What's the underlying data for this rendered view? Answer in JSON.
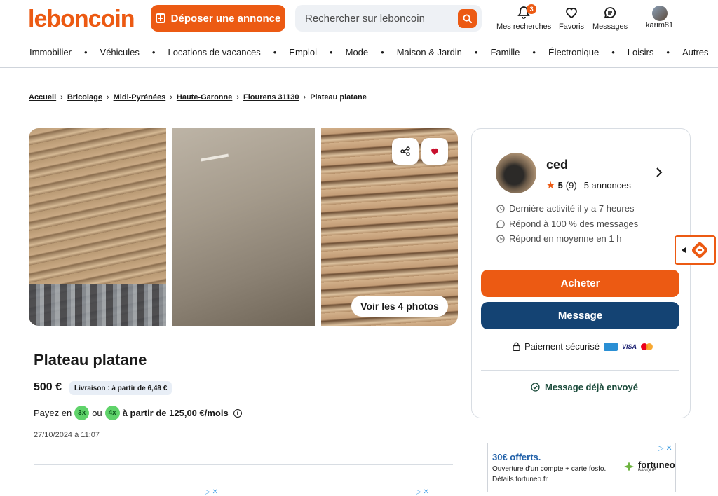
{
  "header": {
    "logo": "leboncoin",
    "deposer_label": "Déposer une annonce",
    "search_placeholder": "Rechercher sur leboncoin",
    "notif_count": "3",
    "items": {
      "recherches": "Mes recherches",
      "favoris": "Favoris",
      "messages": "Messages",
      "user": "karim81"
    }
  },
  "nav": [
    "Immobilier",
    "Véhicules",
    "Locations de vacances",
    "Emploi",
    "Mode",
    "Maison & Jardin",
    "Famille",
    "Électronique",
    "Loisirs",
    "Autres"
  ],
  "breadcrumb": {
    "items": [
      "Accueil",
      "Bricolage",
      "Midi-Pyrénées",
      "Haute-Garonne",
      "Flourens 31130"
    ],
    "current": "Plateau platane"
  },
  "photos": {
    "voir_label": "Voir les 4 photos"
  },
  "listing": {
    "title": "Plateau platane",
    "price": "500 €",
    "livraison": "Livraison : à partir de 6,49 €",
    "payez_prefix": "Payez en",
    "option1": "3x",
    "ou": "ou",
    "option2": "4x",
    "payez_suffix": "à partir de 125,00 €/mois",
    "date": "27/10/2024 à 11:07"
  },
  "seller": {
    "name": "ced",
    "rating": "5",
    "reviews": "(9)",
    "annonces": "5 annonces",
    "stats": [
      "Dernière activité il y a 7 heures",
      "Répond à 100 % des messages",
      "Répond en moyenne en 1 h"
    ],
    "buy_label": "Acheter",
    "message_label": "Message",
    "secure_label": "Paiement sécurisé",
    "visa": "VISA",
    "sent_label": "Message déjà envoyé"
  },
  "ad": {
    "title": "30€ offerts.",
    "line1": "Ouverture d'un compte + carte fosfo.",
    "line2": "Détails fortuneo.fr",
    "brand": "fortuneo",
    "brand_sub": "BANQUE"
  },
  "colors": {
    "accent": "#ec5a13",
    "navy": "#144373",
    "green_pill": "#5fd36a"
  }
}
